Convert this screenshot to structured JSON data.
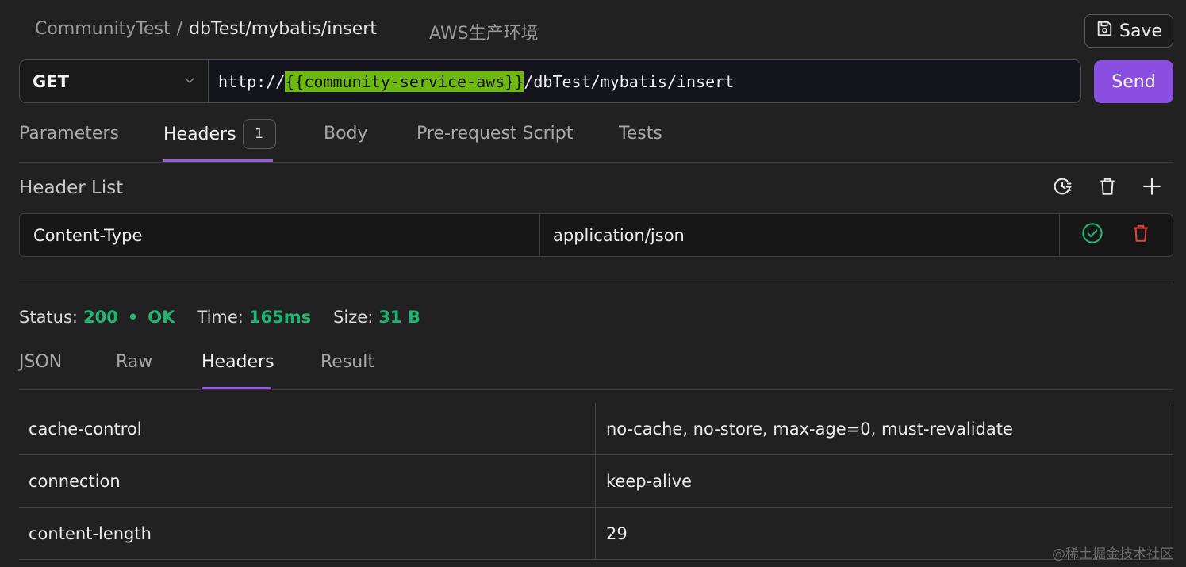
{
  "breadcrumb": {
    "project": "CommunityTest",
    "separator": "/",
    "path": "dbTest/mybatis/insert"
  },
  "environment": "AWS生产环境",
  "save_label": "Save",
  "request": {
    "method": "GET",
    "url_prefix": "http://",
    "url_variable": "{{community-service-aws}}",
    "url_suffix": "/dbTest/mybatis/insert",
    "send_label": "Send"
  },
  "request_tabs": [
    {
      "label": "Parameters"
    },
    {
      "label": "Headers",
      "badge": "1"
    },
    {
      "label": "Body"
    },
    {
      "label": "Pre-request Script"
    },
    {
      "label": "Tests"
    }
  ],
  "header_list": {
    "title": "Header List",
    "rows": [
      {
        "key": "Content-Type",
        "value": "application/json"
      }
    ]
  },
  "status": {
    "status_label": "Status:",
    "status_code": "200",
    "dot": "•",
    "status_text": "OK",
    "time_label": "Time:",
    "time_value": "165ms",
    "size_label": "Size:",
    "size_value": "31 B"
  },
  "response_tabs": [
    {
      "label": "JSON"
    },
    {
      "label": "Raw"
    },
    {
      "label": "Headers"
    },
    {
      "label": "Result"
    }
  ],
  "response_headers": [
    {
      "key": "cache-control",
      "value": "no-cache, no-store, max-age=0, must-revalidate"
    },
    {
      "key": "connection",
      "value": "keep-alive"
    },
    {
      "key": "content-length",
      "value": "29"
    }
  ],
  "watermark": "@稀土掘金技术社区",
  "colors": {
    "accent": "#9b59e8",
    "send": "#8a4ee0",
    "success": "#21b573",
    "variable": "#6db90f",
    "delete": "#e0443e"
  },
  "icons": [
    "save-icon",
    "chevron-down-icon",
    "history-icon",
    "trash-icon",
    "plus-icon",
    "check-circle-icon",
    "delete-icon"
  ]
}
